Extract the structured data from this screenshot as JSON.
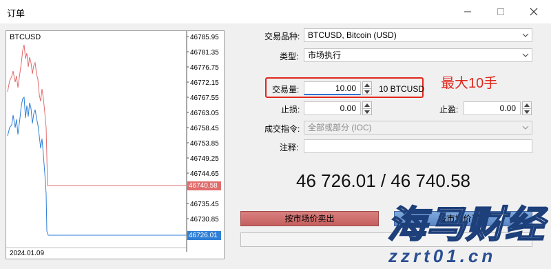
{
  "window": {
    "title": "订单",
    "minimize_icon": "minimize-icon",
    "maximize_icon": "maximize-icon",
    "close_icon": "close-icon"
  },
  "chart": {
    "symbol": "BTCUSD",
    "date_label": "2024.01.09",
    "price_ticks": [
      "46785.95",
      "46781.35",
      "46776.75",
      "46772.15",
      "46767.55",
      "46763.05",
      "46758.45",
      "46753.85",
      "46749.25",
      "46744.65",
      "46740.58",
      "46735.45",
      "46730.85",
      "46726.01"
    ],
    "ask_tag": "46740.58",
    "bid_tag": "46726.01",
    "ask_color": "#e06c6c",
    "bid_color": "#2f7fd6"
  },
  "form": {
    "symbol_label": "交易品种:",
    "symbol_value": "BTCUSD, Bitcoin (USD)",
    "type_label": "类型:",
    "type_value": "市场执行",
    "volume_label": "交易量:",
    "volume_value": "10.00",
    "volume_unit": "10 BTCUSD",
    "stoploss_label": "止损:",
    "stoploss_value": "0.00",
    "takeprofit_label": "止盈:",
    "takeprofit_value": "0.00",
    "filling_label": "成交指令:",
    "filling_value": "全部或部分 (IOC)",
    "comment_label": "注释:",
    "comment_value": ""
  },
  "annotation": {
    "text": "最大10手",
    "color": "#e0281c"
  },
  "quote": {
    "text": "46 726.01 / 46 740.58"
  },
  "actions": {
    "sell_label": "按市场价卖出",
    "buy_label": "按市场价买入"
  },
  "watermark": {
    "logo_text": "海马财经",
    "url": "zzrt01.cn"
  }
}
